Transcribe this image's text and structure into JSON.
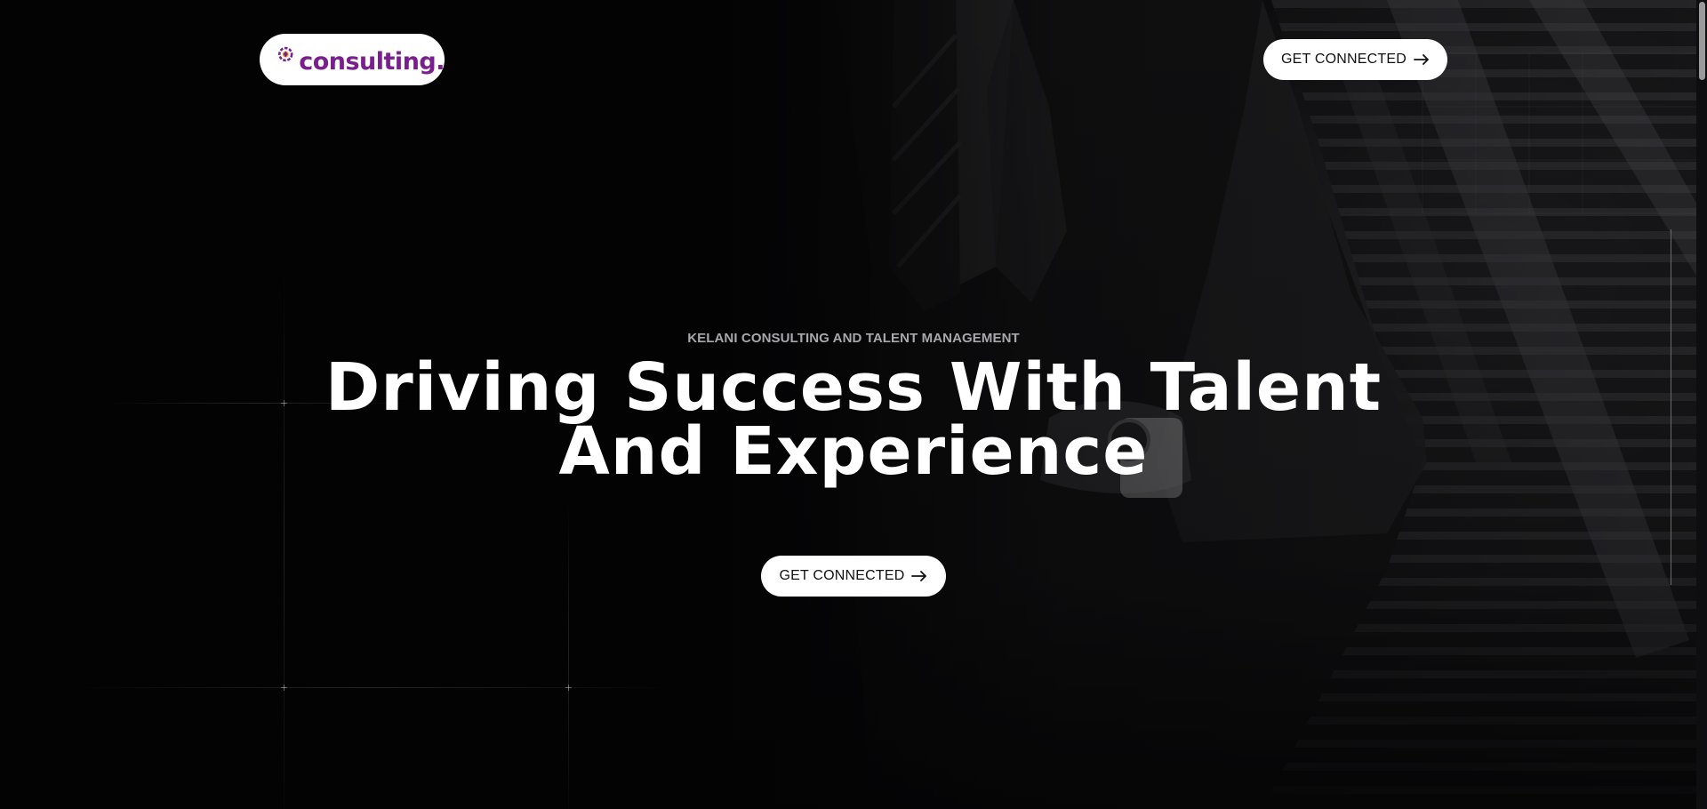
{
  "brand": {
    "logo_text": "consulting.",
    "logo_icon": "gear-spark-icon",
    "logo_color": "#7a1f8e",
    "logo_accent": "#f2a41c"
  },
  "header": {
    "cta_label": "GET CONNECTED",
    "cta_icon": "arrow-right-icon"
  },
  "hero": {
    "eyebrow": "KELANI CONSULTING AND TALENT MANAGEMENT",
    "headline_line1": "Driving Success With Talent",
    "headline_line2": "And Experience",
    "cta_label": "GET CONNECTED",
    "cta_icon": "arrow-right-icon"
  },
  "colors": {
    "background": "#050506",
    "button_bg": "#ffffff",
    "button_text": "#111111",
    "eyebrow": "#a7a7ad"
  }
}
